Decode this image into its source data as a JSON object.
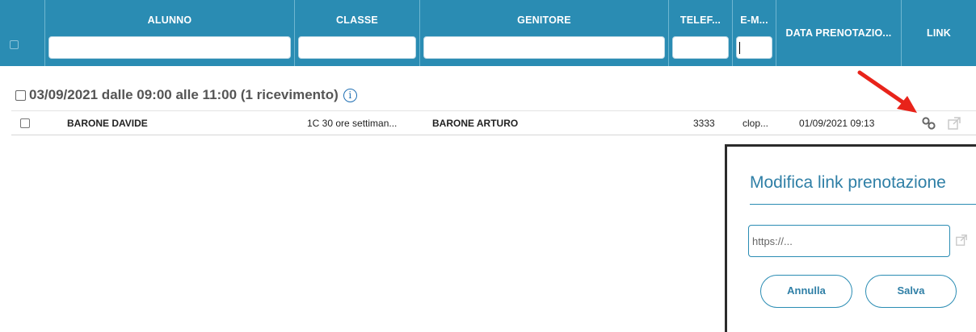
{
  "table": {
    "columns": [
      {
        "label": "ALUNNO",
        "filter": ""
      },
      {
        "label": "CLASSE",
        "filter": ""
      },
      {
        "label": "GENITORE",
        "filter": ""
      },
      {
        "label": "TELEF...",
        "filter": ""
      },
      {
        "label": "E-M...",
        "filter": ""
      },
      {
        "label": "DATA PRENOTAZIO..."
      },
      {
        "label": "LINK"
      }
    ]
  },
  "group": {
    "title": "03/09/2021 dalle 09:00 alle 11:00 (1 ricevimento)",
    "info_icon": "info-circle-icon"
  },
  "rows": [
    {
      "alunno": "BARONE DAVIDE",
      "classe": "1C 30 ore settiman...",
      "genitore": "BARONE ARTURO",
      "telefono": "3333",
      "email": "clop...",
      "data_prenotazione": "01/09/2021 09:13"
    }
  ],
  "modal": {
    "title": "Modifica link prenotazione",
    "url_value": "",
    "url_placeholder": "https://...",
    "cancel_label": "Annulla",
    "save_label": "Salva"
  },
  "colors": {
    "header_bg": "#2a8cb3",
    "accent_text": "#2f7fa6",
    "annotation_arrow": "#e8231a"
  }
}
